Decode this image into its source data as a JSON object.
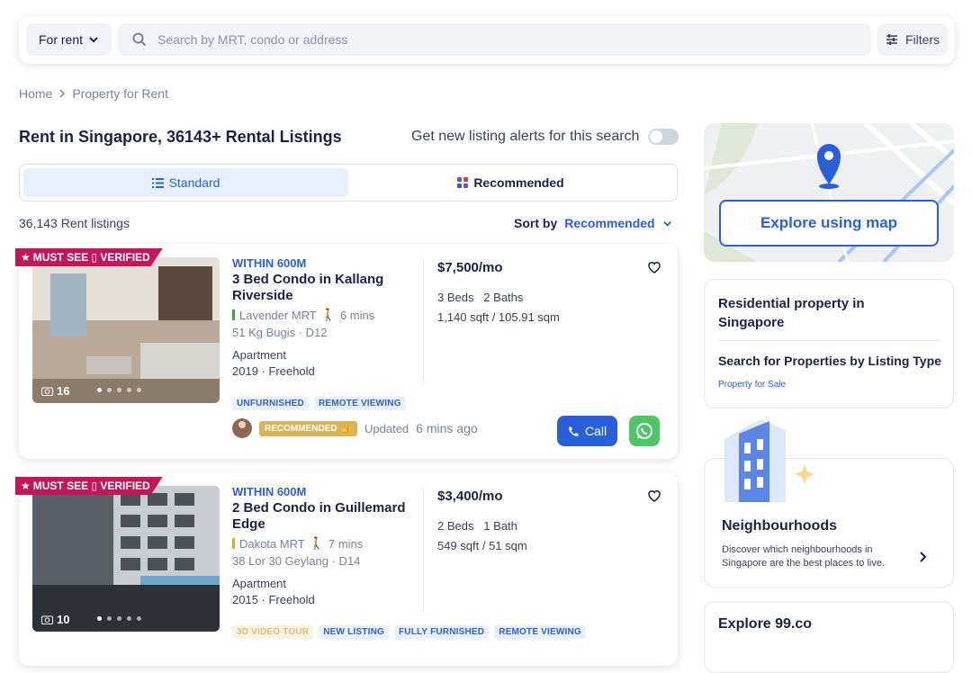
{
  "search": {
    "mode": "For rent",
    "placeholder": "Search by MRT, condo or address",
    "filters_label": "Filters"
  },
  "breadcrumb": {
    "home": "Home",
    "current": "Property for Rent"
  },
  "header": {
    "title": "Rent in Singapore, 36143+ Rental Listings",
    "alerts_label": "Get new listing alerts for this search"
  },
  "view_tabs": {
    "standard": "Standard",
    "recommended": "Recommended"
  },
  "results": {
    "count": "36,143 Rent listings",
    "sort_label": "Sort by",
    "sort_value": "Recommended"
  },
  "listings": [
    {
      "ribbon": "MUST SEE ▯ VERIFIED",
      "photo_count": "16",
      "distance": "WITHIN 600M",
      "title": "3 Bed Condo in Kallang Riverside",
      "mrt": "Lavender MRT",
      "mrt_color": "#3fa34d",
      "walk": "6 mins",
      "address": "51 Kg Bugis · D12",
      "type": "Apartment",
      "year_tenure": "2019 · Freehold",
      "price": "$7,500/mo",
      "beds_baths": "3 Beds   2 Baths",
      "size": "1,140 sqft / 105.91 sqm",
      "tags": [
        "UNFURNISHED",
        "REMOTE VIEWING"
      ],
      "badge": "RECOMMENDED",
      "updated_label": "Updated",
      "updated_value": "6 mins ago",
      "call_label": "Call"
    },
    {
      "ribbon": "MUST SEE ▯ VERIFIED",
      "photo_count": "10",
      "distance": "WITHIN 600M",
      "title": "2 Bed Condo in Guillemard Edge",
      "mrt": "Dakota MRT",
      "mrt_color": "#f2a31b",
      "walk": "7 mins",
      "address": "38 Lor 30 Geylang · D14",
      "type": "Apartment",
      "year_tenure": "2015 · Freehold",
      "price": "$3,400/mo",
      "beds_baths": "2 Beds   1 Bath",
      "size": "549 sqft / 51 sqm",
      "tags": [
        "3D VIDEO TOUR",
        "NEW LISTING",
        "FULLY FURNISHED",
        "REMOTE VIEWING"
      ]
    }
  ],
  "map": {
    "button": "Explore using map"
  },
  "residential": {
    "title": "Residential property in Singapore",
    "subtitle": "Search for Properties by Listing Type",
    "link": "Property for Sale"
  },
  "neighbourhoods": {
    "title": "Neighbourhoods",
    "description": "Discover which neighbourhoods in Singapore are the best places to live."
  },
  "explore": {
    "title": "Explore 99.co"
  },
  "colors": {
    "accent": "#2a5fdb",
    "ribbon": "#c2185b",
    "whatsapp": "#4cc764"
  }
}
